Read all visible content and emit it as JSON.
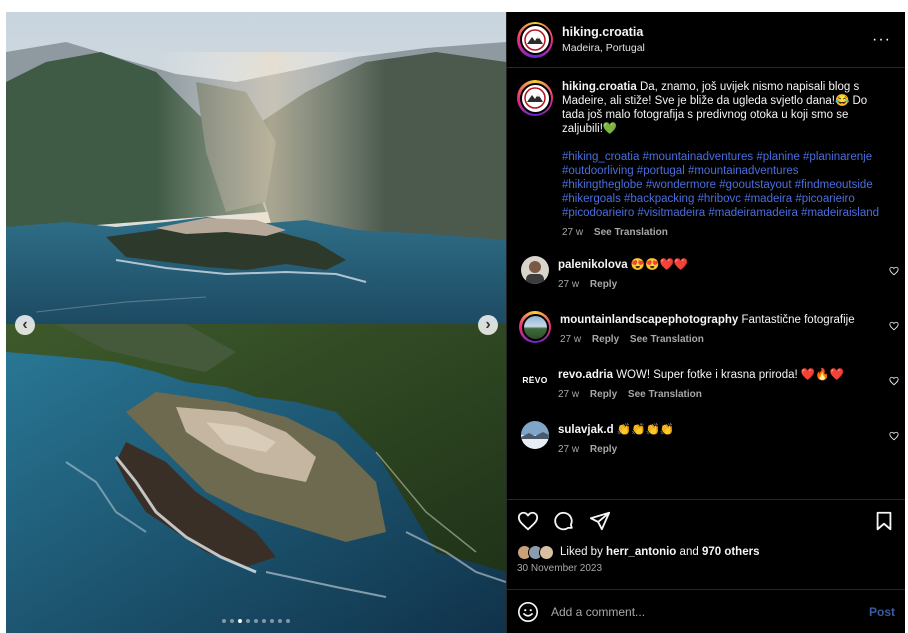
{
  "post": {
    "author": "hiking.croatia",
    "location": "Madeira, Portugal",
    "more_label": "···",
    "caption": "Da, znamo, još uvijek nismo napisali blog s Madeire, ali stiže! Sve je bliže da ugleda svjetlo dana!😂 Do tada još malo fotografija s predivnog otoka u koji smo se zaljubili!💚",
    "hashtags": "#hiking_croatia #mountainadventures #planine #planinarenje #outdoorliving #portugal #mountainadventures #hikingtheglobe #wondermore #gooutstayout #findmeoutside #hikergoals #backpacking #hribovc #madeira #picoarieiro #picodoarieiro #visitmadeira #madeiramadeira #madeiraisland",
    "caption_age": "27 w",
    "see_translation": "See Translation",
    "avatar_icon": "mountain-logo-icon"
  },
  "carousel": {
    "prev_label": "‹",
    "next_label": "›",
    "total_dots": 9,
    "active_dot": 2
  },
  "comments": [
    {
      "user": "palenikolova",
      "text": "😍😍❤️❤️",
      "age": "27 w",
      "reply": "Reply",
      "translate": ""
    },
    {
      "user": "mountainlandscapephotography",
      "text": "Fantastične fotografije",
      "age": "27 w",
      "reply": "Reply",
      "translate": "See Translation"
    },
    {
      "user": "revo.adria",
      "text": "WOW! Super fotke i krasna priroda! ❤️🔥❤️",
      "age": "27 w",
      "reply": "Reply",
      "translate": "See Translation",
      "avatar_text": "RЁVO"
    },
    {
      "user": "sulavjak.d",
      "text": "👏👏👏👏",
      "age": "27 w",
      "reply": "Reply",
      "translate": ""
    }
  ],
  "likes": {
    "prefix": "Liked by",
    "first_user": "herr_antonio",
    "joiner": "and",
    "others": "970 others"
  },
  "date": "30 November 2023",
  "add_comment": {
    "placeholder": "Add a comment...",
    "post_label": "Post"
  },
  "colors": {
    "link": "#4a6ee0",
    "post_button": "#3b5ba0",
    "background": "#000000"
  }
}
